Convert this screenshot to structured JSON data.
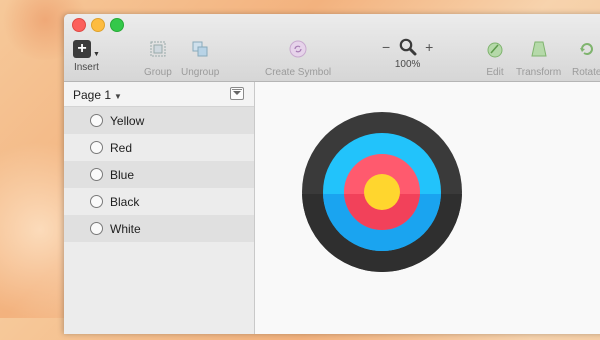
{
  "toolbar": {
    "insert": "Insert",
    "group": "Group",
    "ungroup": "Ungroup",
    "create_symbol": "Create Symbol",
    "zoom_minus": "−",
    "zoom_plus": "+",
    "zoom_level": "100%",
    "edit": "Edit",
    "transform": "Transform",
    "rotate": "Rotate"
  },
  "sidebar": {
    "page_name": "Page 1",
    "layers": [
      {
        "label": "Yellow"
      },
      {
        "label": "Red"
      },
      {
        "label": "Blue"
      },
      {
        "label": "Black"
      },
      {
        "label": "White"
      }
    ]
  },
  "canvas": {
    "target_colors": {
      "outer": "#3a3a3a",
      "blue": "#1ea6f2",
      "red": "#f44a5e",
      "yellow": "#ffd62e"
    }
  }
}
